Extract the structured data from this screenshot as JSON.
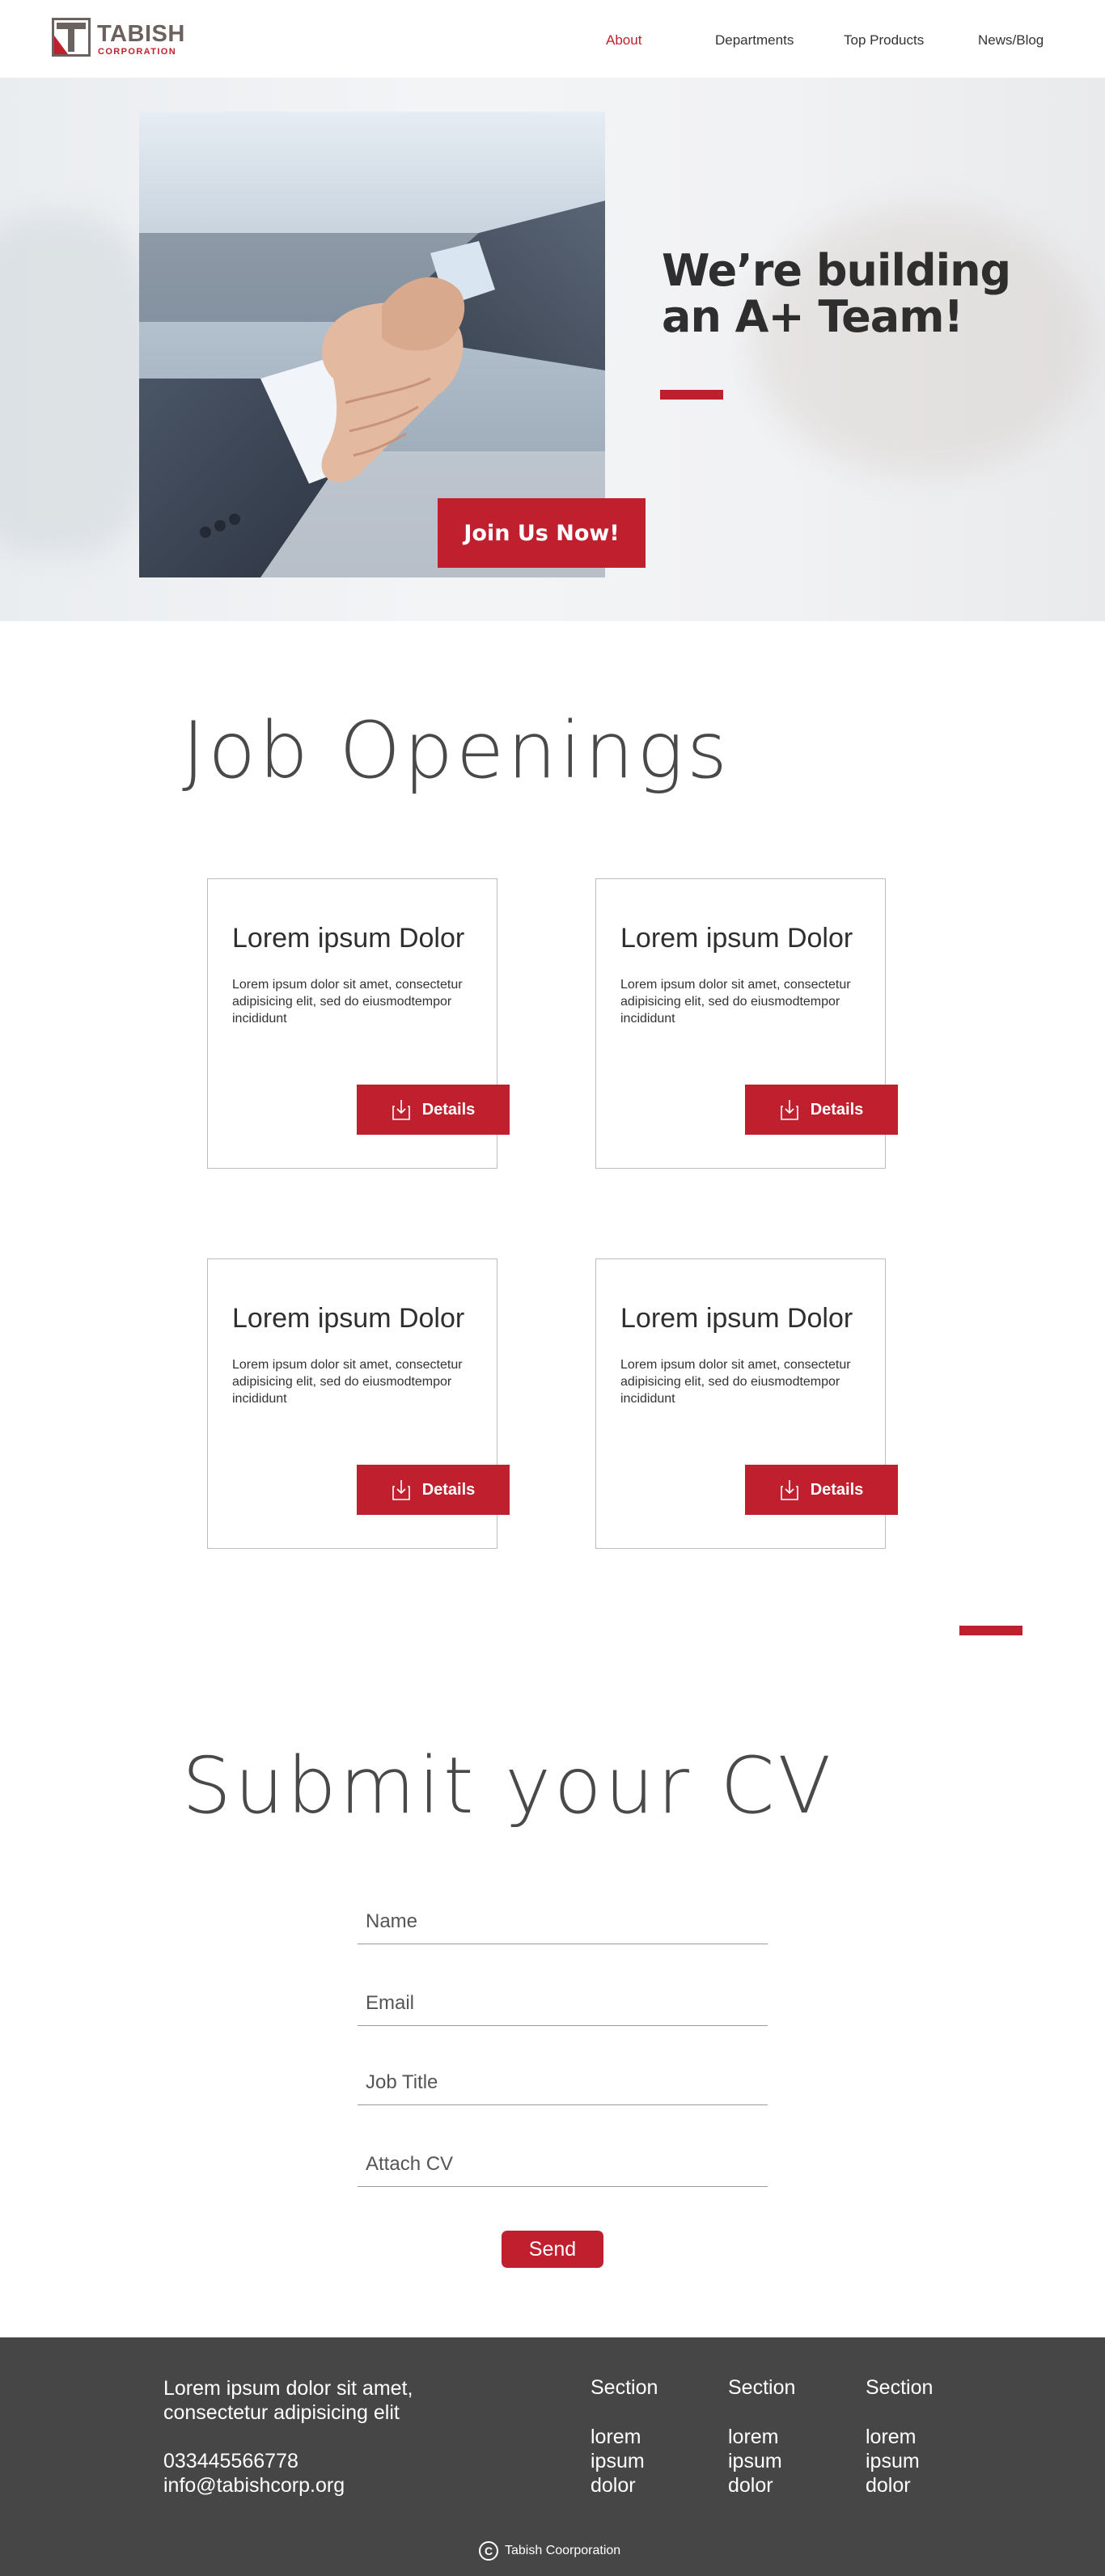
{
  "brand": {
    "name": "TABISH",
    "subtitle": "CORPORATION",
    "colors": {
      "accent": "#c0202e",
      "logo_gray": "#6b6260",
      "footer_bg": "#464646"
    }
  },
  "nav": {
    "items": [
      {
        "label": "About",
        "active": true
      },
      {
        "label": "Departments",
        "active": false
      },
      {
        "label": "Top Products",
        "active": false
      },
      {
        "label": "News/Blog",
        "active": false
      }
    ]
  },
  "hero": {
    "title": "We’re building an A+ Team!",
    "cta_label": "Join Us Now!"
  },
  "jobs": {
    "section_title": "Job Openings",
    "cards": [
      {
        "title": "Lorem ipsum Dolor",
        "description": "Lorem ipsum dolor sit amet, consectetur adipisicing elit, sed do eiusmodtempor incididunt",
        "button_label": "Details",
        "button_icon": "download-icon"
      },
      {
        "title": "Lorem ipsum Dolor",
        "description": "Lorem ipsum dolor sit amet, consectetur adipisicing elit, sed do eiusmodtempor incididunt",
        "button_label": "Details",
        "button_icon": "download-icon"
      },
      {
        "title": "Lorem ipsum Dolor",
        "description": "Lorem ipsum dolor sit amet, consectetur adipisicing elit, sed do eiusmodtempor incididunt",
        "button_label": "Details",
        "button_icon": "download-icon"
      },
      {
        "title": "Lorem ipsum Dolor",
        "description": "Lorem ipsum dolor sit amet, consectetur adipisicing elit, sed do eiusmodtempor incididunt",
        "button_label": "Details",
        "button_icon": "download-icon"
      }
    ]
  },
  "cv_form": {
    "section_title": "Submit your CV",
    "fields": [
      {
        "label": "Name"
      },
      {
        "label": "Email"
      },
      {
        "label": "Job Title"
      },
      {
        "label": "Attach CV"
      }
    ],
    "submit_label": "Send"
  },
  "footer": {
    "tagline_line1": "Lorem ipsum dolor sit amet,",
    "tagline_line2": "consectetur adipisicing elit",
    "phone": "033445566778",
    "email": "info@tabishcorp.org",
    "columns": [
      {
        "title": "Section",
        "links": [
          "lorem",
          "ipsum",
          "dolor"
        ]
      },
      {
        "title": "Section",
        "links": [
          "lorem",
          "ipsum",
          "dolor"
        ]
      },
      {
        "title": "Section",
        "links": [
          "lorem",
          "ipsum",
          "dolor"
        ]
      }
    ],
    "copyright_icon": "copyright-icon",
    "copyright_text": "Tabish Coorporation"
  }
}
